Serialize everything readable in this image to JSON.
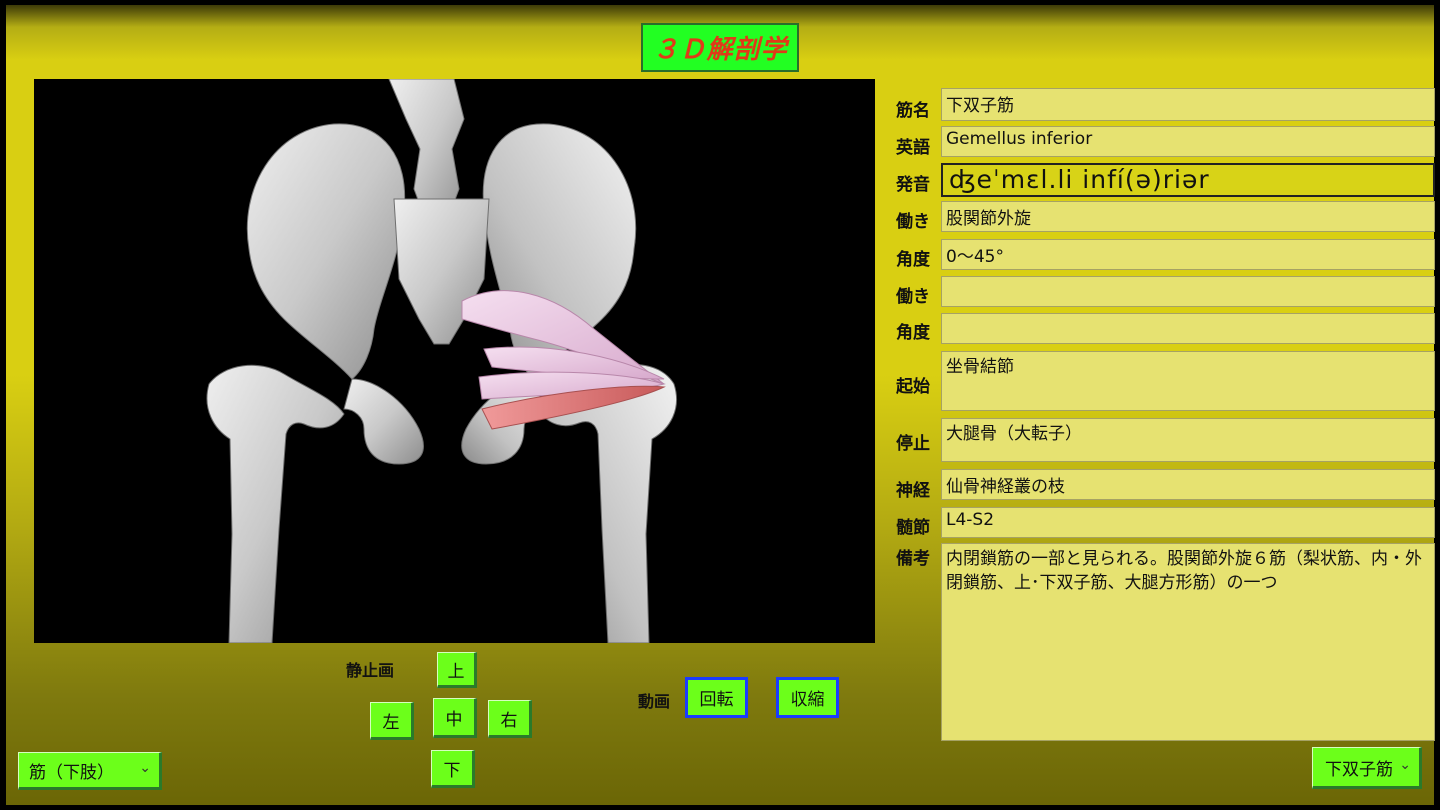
{
  "app": {
    "title": "３Ｄ解剖学"
  },
  "fields": [
    {
      "label": "筋名",
      "value": "下双子筋"
    },
    {
      "label": "英語",
      "value": "Gemellus inferior"
    },
    {
      "label": "発音",
      "value": "ʤeˈmɛl.li infí(ə)riər"
    },
    {
      "label": "働き",
      "value": "股関節外旋"
    },
    {
      "label": "角度",
      "value": "0〜45°"
    },
    {
      "label": "働き",
      "value": ""
    },
    {
      "label": "角度",
      "value": ""
    },
    {
      "label": "起始",
      "value": "坐骨結節"
    },
    {
      "label": "停止",
      "value": "大腿骨（大転子）"
    },
    {
      "label": "神経",
      "value": "仙骨神経叢の枝"
    },
    {
      "label": "髄節",
      "value": "L4-S2"
    },
    {
      "label": "備考",
      "value": "内閉鎖筋の一部と見られる。股関節外旋６筋（梨状筋、内・外閉鎖筋、上･下双子筋、大腿方形筋）の一つ"
    }
  ],
  "static_view": {
    "label": "静止画",
    "up": "上",
    "left": "左",
    "center": "中",
    "right": "右",
    "down": "下"
  },
  "animation": {
    "label": "動画",
    "rotate": "回転",
    "contract": "収縮"
  },
  "category_select": {
    "value": "筋（下肢）"
  },
  "muscle_select": {
    "value": "下双子筋"
  },
  "icons": {
    "dropdown": "chevron-down-icon"
  },
  "colors": {
    "panel_bg": "#d9cf12",
    "button_green": "#6cff1a",
    "title_text": "#e03a18",
    "muscle_highlight": "#e27d7d",
    "muscle_other": "#efcde6"
  }
}
